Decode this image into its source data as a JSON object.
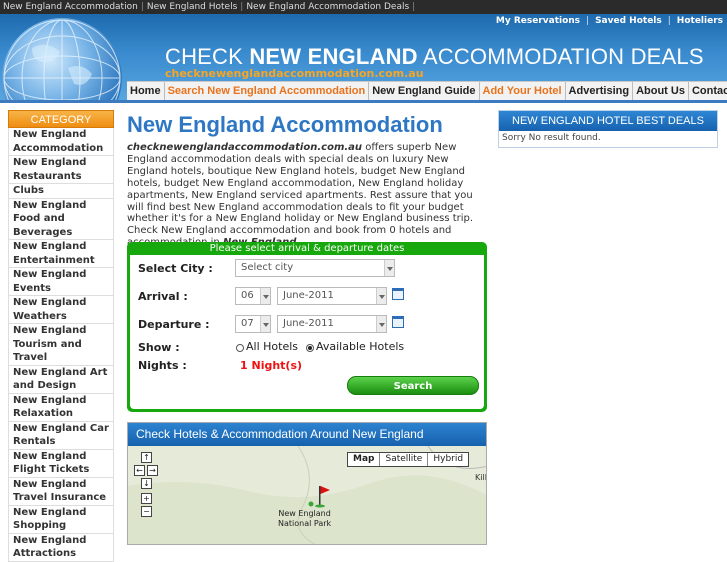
{
  "topbar": {
    "links": [
      "New England Accommodation",
      "New England Hotels",
      "New England Accommodation Deals"
    ]
  },
  "header": {
    "toplinks": [
      "My Reservations",
      "Saved Hotels",
      "Hoteliers"
    ],
    "title_pre": "CHECK",
    "title_bold": "NEW ENGLAND",
    "title_post": "ACCOMMODATION DEALS",
    "url": "checknewenglandaccommodation.com.au",
    "accent_color": "#f6a623",
    "header_color": "#2a7bc4"
  },
  "nav": {
    "items": [
      "Home",
      "Search New England Accommodation",
      "New England Guide",
      "Add Your Hotel",
      "Advertising",
      "About Us",
      "Contact Us"
    ]
  },
  "sidebar": {
    "heading": "CATEGORY",
    "items": [
      "New England Accommodation",
      "New England Restaurants",
      "Clubs",
      "New England Food and Beverages",
      "New England Entertainment",
      "New England Events",
      "New England Weathers",
      "New England Tourism and Travel",
      "New England Art and Design",
      "New England Relaxation",
      "New England Car Rentals",
      "New England Flight Tickets",
      "New England Travel Insurance",
      "New England Shopping",
      "New England Attractions"
    ]
  },
  "main": {
    "title": "New England Accommodation",
    "intro_site": "checknewenglandaccommodation.com.au",
    "intro_text": " offers superb New England accommodation deals with special deals on luxury New England hotels, boutique New England hotels, budget New England hotels, budget New England accommodation, New England holiday apartments, New England serviced apartments. Rest assure that you will find best New England accommodation deals to fit your budget whether it's for a New England holiday or New England business trip. Check New England accommodation and book from 0 hotels and accommodation in ",
    "intro_place": "New England",
    "intro_end": "."
  },
  "search": {
    "heading": "Please select arrival & departure dates",
    "city_label": "Select City :",
    "city_placeholder": "Select city",
    "arrival_label": "Arrival :",
    "arrival_day": "06",
    "arrival_month": "June-2011",
    "departure_label": "Departure :",
    "departure_day": "07",
    "departure_month": "June-2011",
    "show_label": "Show :",
    "option_all": "All Hotels",
    "option_available": "Available Hotels",
    "selected_option": "Available Hotels",
    "nights_label": "Nights :",
    "nights_value": "1 Night(s)",
    "button_label": "Search"
  },
  "map": {
    "heading": "Check Hotels & Accommodation Around New England",
    "types": [
      "Map",
      "Satellite",
      "Hybrid"
    ],
    "active_type": "Map",
    "controls": [
      "↑",
      "←",
      "→",
      "↓",
      "+",
      "−"
    ],
    "marker_label_line1": "New England",
    "marker_label_line2": "National Park",
    "edge_label": "Kill"
  },
  "deals": {
    "heading": "NEW ENGLAND HOTEL BEST DEALS",
    "message": "Sorry No result found."
  }
}
